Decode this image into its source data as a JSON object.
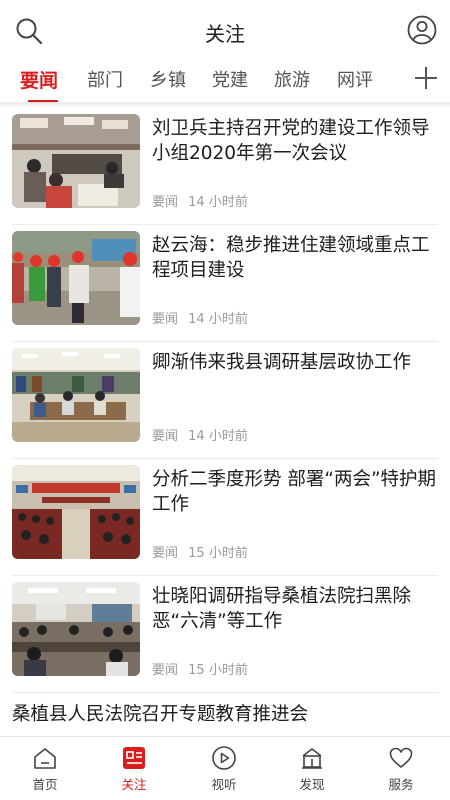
{
  "header": {
    "title": "关注",
    "icons": [
      "search-icon",
      "user-icon"
    ]
  },
  "tabs": [
    {
      "label": "要闻",
      "active": true
    },
    {
      "label": "部门",
      "active": false
    },
    {
      "label": "乡镇",
      "active": false
    },
    {
      "label": "党建",
      "active": false
    },
    {
      "label": "旅游",
      "active": false
    },
    {
      "label": "网评",
      "active": false
    }
  ],
  "colors": {
    "accent": "#d7201d",
    "meta_text": "#9a9a9a"
  },
  "news": [
    {
      "title": "刘卫兵主持召开党的建设工作领导小组2020年第一次会议",
      "source": "要闻",
      "time": "14 小时前"
    },
    {
      "title": "赵云海：稳步推进住建领域重点工程项目建设",
      "source": "要闻",
      "time": "14 小时前"
    },
    {
      "title": "卿渐伟来我县调研基层政协工作",
      "source": "要闻",
      "time": "14 小时前"
    },
    {
      "title": "分析二季度形势 部署“两会”特护期工作",
      "source": "要闻",
      "time": "15 小时前"
    },
    {
      "title": "壮晓阳调研指导桑植法院扫黑除恶“六清”等工作",
      "source": "要闻",
      "time": "15 小时前"
    }
  ],
  "partial_news": {
    "title": "桑植县人民法院召开专题教育推进会"
  },
  "bottom_nav": [
    {
      "label": "首页",
      "icon": "home-icon",
      "active": false
    },
    {
      "label": "关注",
      "icon": "news-icon",
      "active": true
    },
    {
      "label": "视听",
      "icon": "play-icon",
      "active": false
    },
    {
      "label": "发现",
      "icon": "discover-icon",
      "active": false
    },
    {
      "label": "服务",
      "icon": "heart-icon",
      "active": false
    }
  ]
}
